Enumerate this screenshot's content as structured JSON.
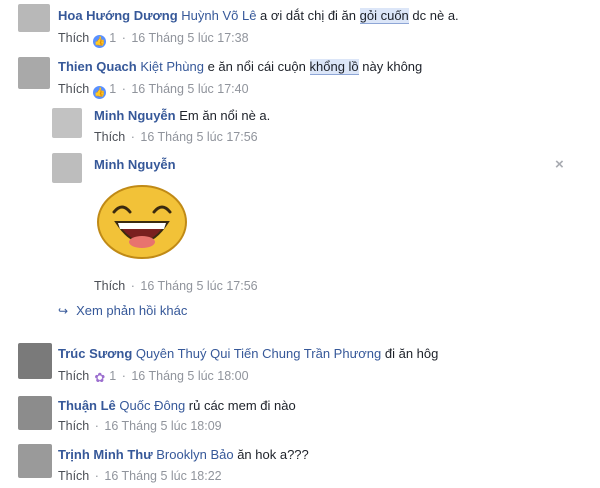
{
  "comments": [
    {
      "author": "Hoa Hướng Dương",
      "tag": "Huỳnh Võ Lê",
      "text_before": " a ơi dắt chị đi ăn ",
      "highlight": "gỏi cuốn",
      "text_after": " dc nè a.",
      "like": "Thích",
      "reactions": "1",
      "time": "16 Tháng 5 lúc 17:38",
      "reaction_icon": "like-icon"
    },
    {
      "author": "Thien Quach",
      "tag": "Kiệt Phùng",
      "text_before": " e ăn nổi cái cuộn ",
      "highlight": "khổng lồ",
      "text_after": " này không",
      "like": "Thích",
      "reactions": "1",
      "time": "16 Tháng 5 lúc 17:40",
      "reaction_icon": "like-icon"
    }
  ],
  "replies": [
    {
      "author": "Minh Nguyễn",
      "text": " Em ăn nổi nè a.",
      "like": "Thích",
      "time": "16 Tháng 5 lúc 17:56"
    },
    {
      "author": "Minh Nguyễn",
      "like": "Thích",
      "time": "16 Tháng 5 lúc 17:56",
      "close": "×"
    }
  ],
  "more_replies": "Xem phản hồi khác",
  "comments2": [
    {
      "author": "Trúc Sương",
      "tag": "Quyên Thuý Qui Tiến Chung Trần Phương",
      "text": " đi ăn hôg",
      "like": "Thích",
      "reactions": "1",
      "time": "16 Tháng 5 lúc 18:00",
      "reaction_icon": "flower-icon"
    },
    {
      "author": "Thuận Lê",
      "tag": "Quốc Đông",
      "text": " rủ các mem đi nào",
      "like": "Thích",
      "time": "16 Tháng 5 lúc 18:09"
    },
    {
      "author": "Trịnh Minh Thư",
      "tag": "Brooklyn Bảo",
      "text": " ăn hok a???",
      "like": "Thích",
      "time": "16 Tháng 5 lúc 18:22"
    }
  ]
}
